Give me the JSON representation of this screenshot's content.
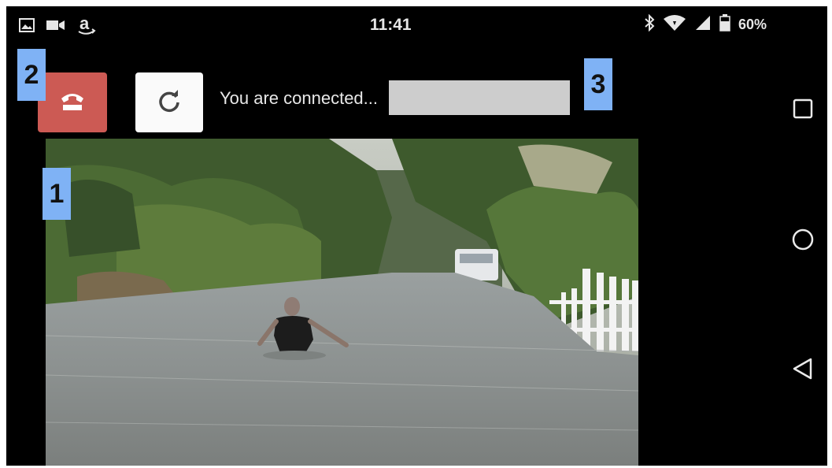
{
  "status_bar": {
    "time": "11:41",
    "battery_percent": "60%",
    "left_icons": [
      "image-icon",
      "video-camera-icon",
      "amazon-icon"
    ],
    "right_icons": [
      "bluetooth-icon",
      "wifi-icon",
      "signal-icon",
      "battery-icon"
    ]
  },
  "call": {
    "status_text": "You are connected...",
    "hangup_icon": "phone-hangup-icon",
    "refresh_icon": "refresh-icon"
  },
  "annotations": [
    "1",
    "2",
    "3"
  ],
  "nav": {
    "buttons": [
      "overview-square-icon",
      "home-circle-icon",
      "back-triangle-icon"
    ]
  },
  "colors": {
    "hangup": "#cc5a54",
    "badge": "#7fb2f5",
    "field": "#cdcdcd"
  }
}
